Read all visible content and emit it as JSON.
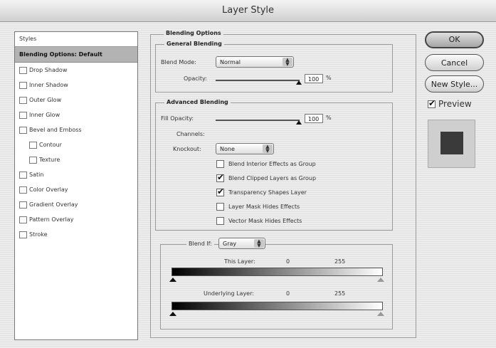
{
  "window": {
    "title": "Layer Style"
  },
  "styles_panel": {
    "header": "Styles",
    "items": [
      {
        "label": "Blending Options: Default",
        "selected": true,
        "checkbox": false,
        "indent": false
      },
      {
        "label": "Drop Shadow",
        "checkbox": true,
        "indent": false
      },
      {
        "label": "Inner Shadow",
        "checkbox": true,
        "indent": false
      },
      {
        "label": "Outer Glow",
        "checkbox": true,
        "indent": false
      },
      {
        "label": "Inner Glow",
        "checkbox": true,
        "indent": false
      },
      {
        "label": "Bevel and Emboss",
        "checkbox": true,
        "indent": false
      },
      {
        "label": "Contour",
        "checkbox": true,
        "indent": true
      },
      {
        "label": "Texture",
        "checkbox": true,
        "indent": true
      },
      {
        "label": "Satin",
        "checkbox": true,
        "indent": false
      },
      {
        "label": "Color Overlay",
        "checkbox": true,
        "indent": false
      },
      {
        "label": "Gradient Overlay",
        "checkbox": true,
        "indent": false
      },
      {
        "label": "Pattern Overlay",
        "checkbox": true,
        "indent": false
      },
      {
        "label": "Stroke",
        "checkbox": true,
        "indent": false
      }
    ]
  },
  "blending": {
    "title": "Blending Options",
    "general": {
      "title": "General Blending",
      "blend_mode_label": "Blend Mode:",
      "blend_mode_value": "Normal",
      "opacity_label": "Opacity:",
      "opacity_value": "100",
      "percent": "%"
    },
    "advanced": {
      "title": "Advanced Blending",
      "fill_opacity_label": "Fill Opacity:",
      "fill_opacity_value": "100",
      "percent": "%",
      "channels_label": "Channels:",
      "knockout_label": "Knockout:",
      "knockout_value": "None",
      "options": [
        {
          "label": "Blend Interior Effects as Group",
          "checked": false
        },
        {
          "label": "Blend Clipped Layers as Group",
          "checked": true
        },
        {
          "label": "Transparency Shapes Layer",
          "checked": true
        },
        {
          "label": "Layer Mask Hides Effects",
          "checked": false
        },
        {
          "label": "Vector Mask Hides Effects",
          "checked": false
        }
      ]
    },
    "blend_if": {
      "label": "Blend If:",
      "value": "Gray",
      "this_layer_label": "This Layer:",
      "this_layer_low": "0",
      "this_layer_high": "255",
      "underlying_label": "Underlying Layer:",
      "underlying_low": "0",
      "underlying_high": "255"
    }
  },
  "buttons": {
    "ok": "OK",
    "cancel": "Cancel",
    "new_style": "New Style..."
  },
  "preview": {
    "label": "Preview",
    "checked": true,
    "swatch_color": "#3a3a3a"
  }
}
